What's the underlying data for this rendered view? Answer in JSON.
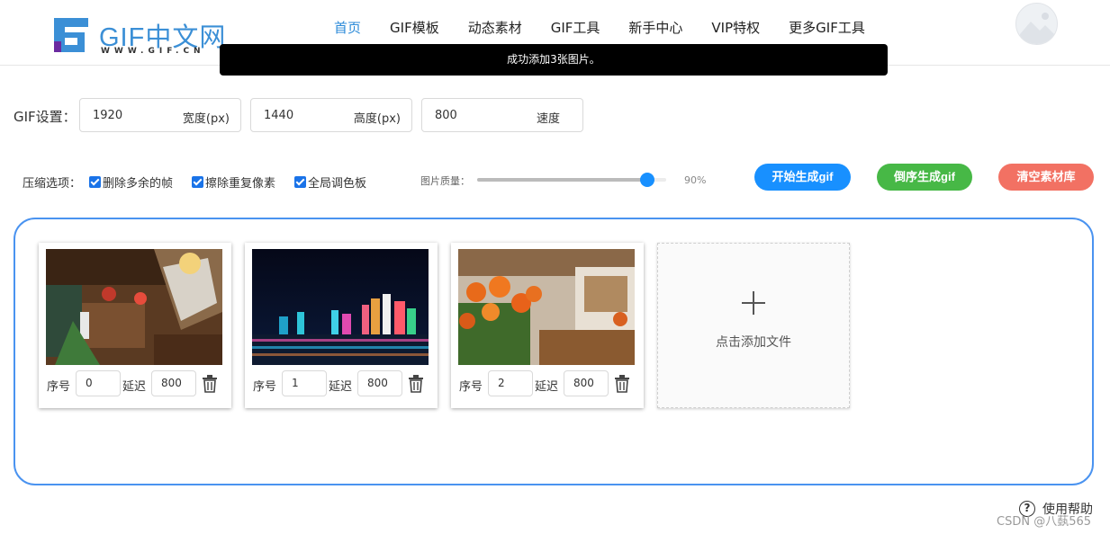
{
  "header": {
    "logo_text": "GIF中文网",
    "logo_sub": "WWW.GIF.CN",
    "nav": [
      "首页",
      "GIF模板",
      "动态素材",
      "GIF工具",
      "新手中心",
      "VIP特权",
      "更多GIF工具"
    ],
    "active_nav": "首页"
  },
  "toast": {
    "message": "成功添加3张图片。"
  },
  "settings": {
    "label": "GIF设置：",
    "width": {
      "value": "1920",
      "unit": "宽度(px)"
    },
    "height": {
      "value": "1440",
      "unit": "高度(px)"
    },
    "speed": {
      "value": "800",
      "unit": "速度"
    }
  },
  "compress": {
    "label": "压缩选项：",
    "options": [
      {
        "label": "删除多余的帧",
        "checked": true
      },
      {
        "label": "擦除重复像素",
        "checked": true
      },
      {
        "label": "全局调色板",
        "checked": true
      }
    ],
    "quality_label": "图片质量：",
    "quality_value": "90%",
    "quality_fraction": 0.9
  },
  "buttons": {
    "generate": "开始生成gif",
    "reverse": "倒序生成gif",
    "clear": "清空素材库"
  },
  "frames": {
    "index_label": "序号",
    "delay_label": "延迟",
    "items": [
      {
        "index": "0",
        "delay": "800",
        "image": "restaurant-interior"
      },
      {
        "index": "1",
        "delay": "800",
        "image": "city-night-skyline"
      },
      {
        "index": "2",
        "delay": "800",
        "image": "orange-roses-cafe"
      }
    ]
  },
  "add_file": {
    "label": "点击添加文件"
  },
  "help": {
    "label": "使用帮助"
  },
  "watermark": "CSDN @八蓺565",
  "colors": {
    "primary": "#1890ff",
    "green": "#47b846",
    "red": "#f27163",
    "border_blue": "#4a93f0"
  }
}
